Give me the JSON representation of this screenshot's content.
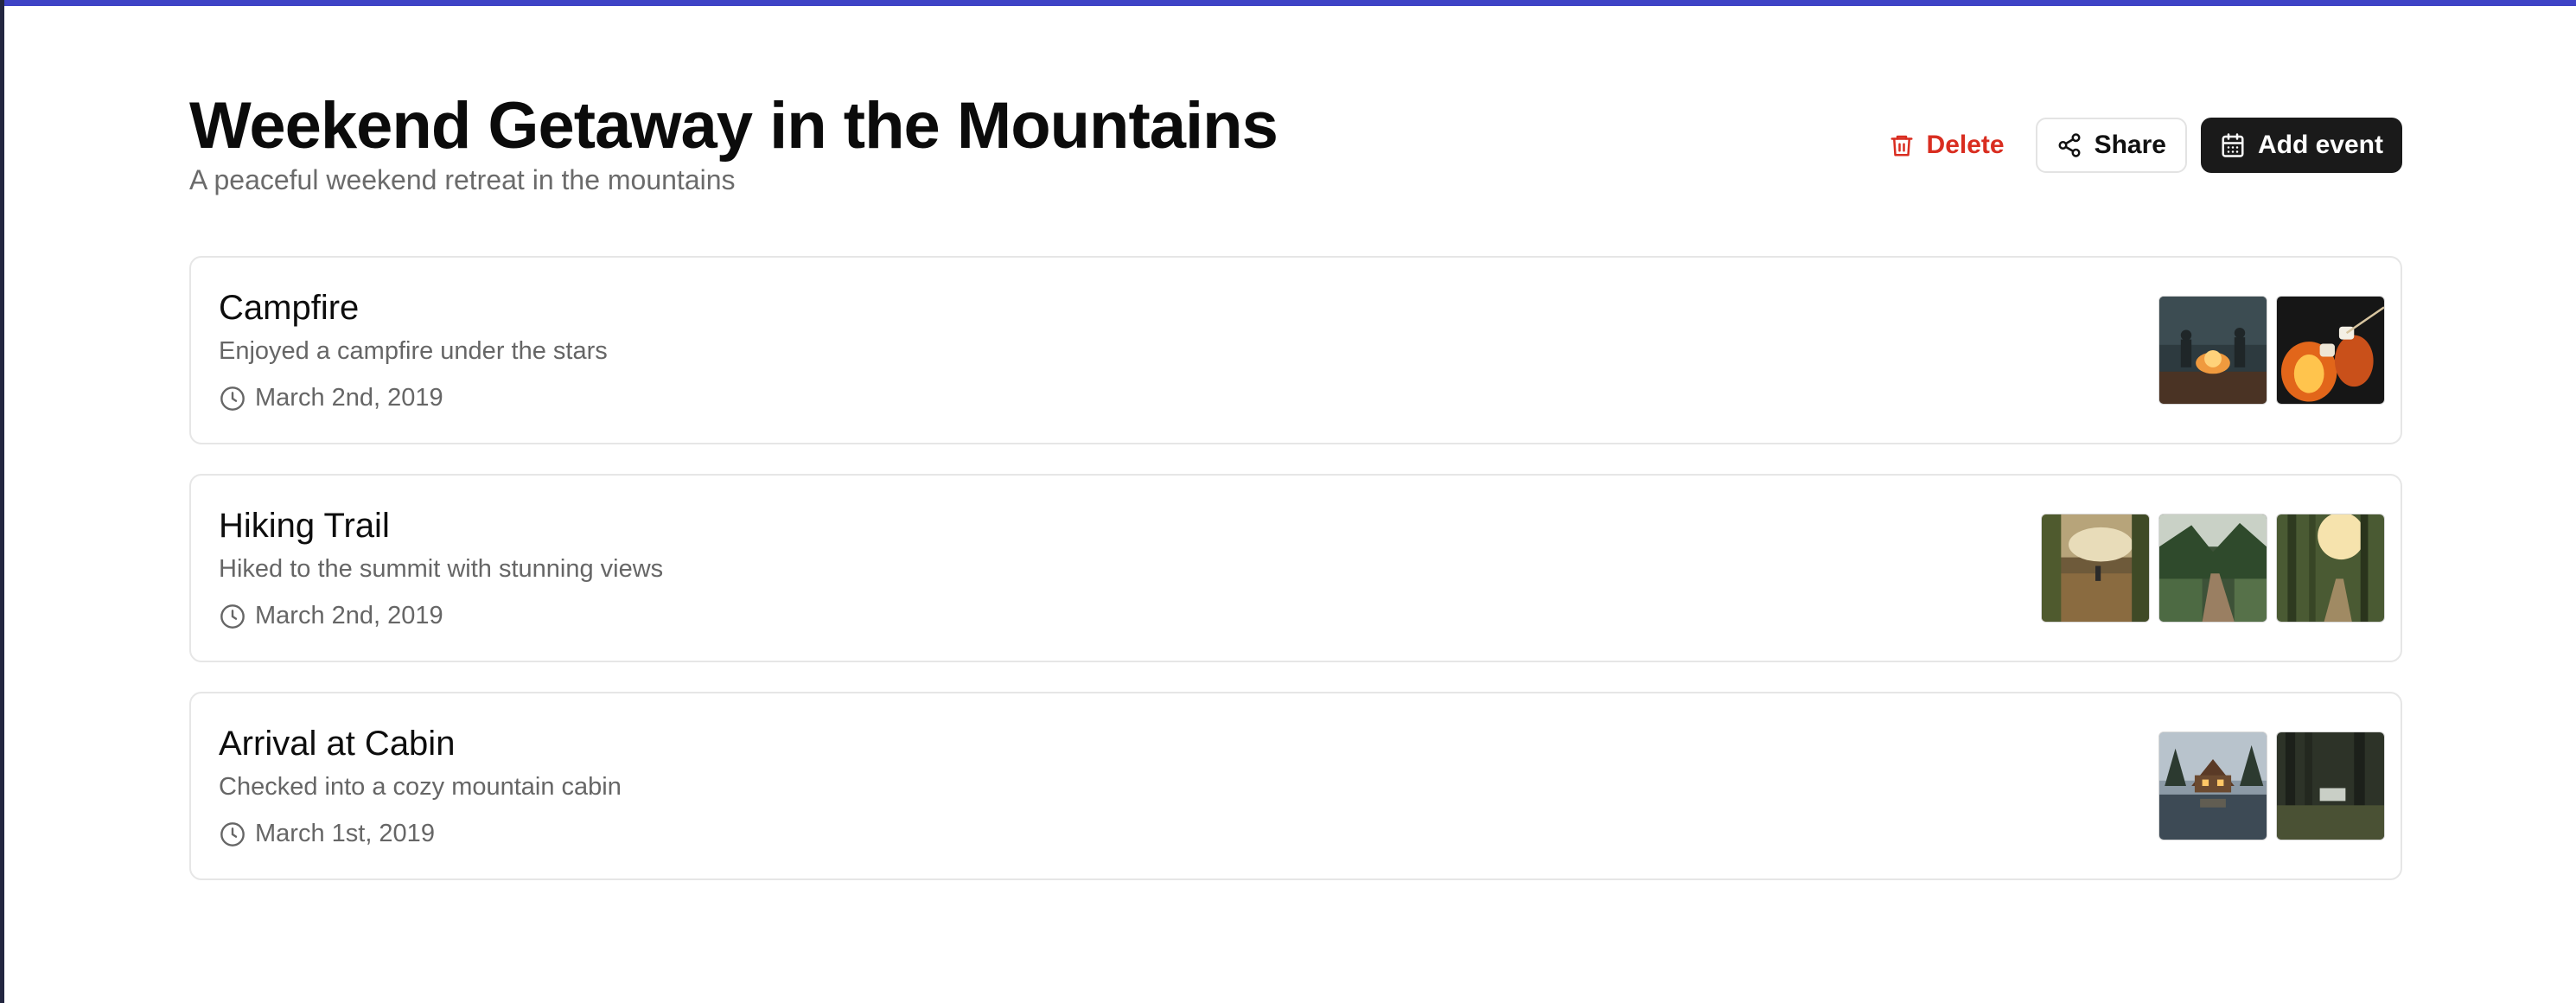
{
  "header": {
    "title": "Weekend Getaway in the Mountains",
    "subtitle": "A peaceful weekend retreat in the mountains"
  },
  "actions": {
    "delete_label": "Delete",
    "share_label": "Share",
    "add_event_label": "Add event"
  },
  "colors": {
    "accent": "#3e43c6",
    "danger": "#d92d20",
    "primary_button": "#1a1a1a"
  },
  "events": [
    {
      "title": "Campfire",
      "description": "Enjoyed a campfire under the stars",
      "date": "March 2nd, 2019",
      "photos": [
        "campfire-group-photo",
        "marshmallow-roast-photo"
      ]
    },
    {
      "title": "Hiking Trail",
      "description": "Hiked to the summit with stunning views",
      "date": "March 2nd, 2019",
      "photos": [
        "meadow-hiker-photo",
        "forest-trail-photo",
        "sunlit-forest-photo"
      ]
    },
    {
      "title": "Arrival at Cabin",
      "description": "Checked into a cozy mountain cabin",
      "date": "March 1st, 2019",
      "photos": [
        "snowy-cabin-lake-photo",
        "dark-forest-cabin-photo"
      ]
    }
  ]
}
